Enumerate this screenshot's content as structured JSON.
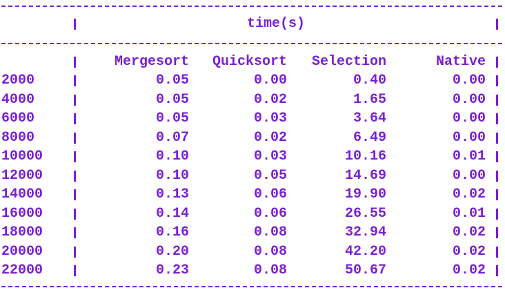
{
  "header": {
    "title": "time(s)",
    "columns": [
      "Mergesort",
      "Quicksort",
      "Selection",
      "Native"
    ]
  },
  "rows": [
    {
      "size": "2000",
      "mergesort": "0.05",
      "quicksort": "0.00",
      "selection": "0.40",
      "native": "0.00"
    },
    {
      "size": "4000",
      "mergesort": "0.05",
      "quicksort": "0.02",
      "selection": "1.65",
      "native": "0.00"
    },
    {
      "size": "6000",
      "mergesort": "0.05",
      "quicksort": "0.03",
      "selection": "3.64",
      "native": "0.00"
    },
    {
      "size": "8000",
      "mergesort": "0.07",
      "quicksort": "0.02",
      "selection": "6.49",
      "native": "0.00"
    },
    {
      "size": "10000",
      "mergesort": "0.10",
      "quicksort": "0.03",
      "selection": "10.16",
      "native": "0.01"
    },
    {
      "size": "12000",
      "mergesort": "0.10",
      "quicksort": "0.05",
      "selection": "14.69",
      "native": "0.00"
    },
    {
      "size": "14000",
      "mergesort": "0.13",
      "quicksort": "0.06",
      "selection": "19.90",
      "native": "0.02"
    },
    {
      "size": "16000",
      "mergesort": "0.14",
      "quicksort": "0.06",
      "selection": "26.55",
      "native": "0.01"
    },
    {
      "size": "18000",
      "mergesort": "0.16",
      "quicksort": "0.08",
      "selection": "32.94",
      "native": "0.02"
    },
    {
      "size": "20000",
      "mergesort": "0.20",
      "quicksort": "0.08",
      "selection": "42.20",
      "native": "0.02"
    },
    {
      "size": "22000",
      "mergesort": "0.23",
      "quicksort": "0.08",
      "selection": "50.67",
      "native": "0.02"
    }
  ],
  "colors": {
    "text": "#7a1fd6",
    "background": "#ffffff"
  }
}
